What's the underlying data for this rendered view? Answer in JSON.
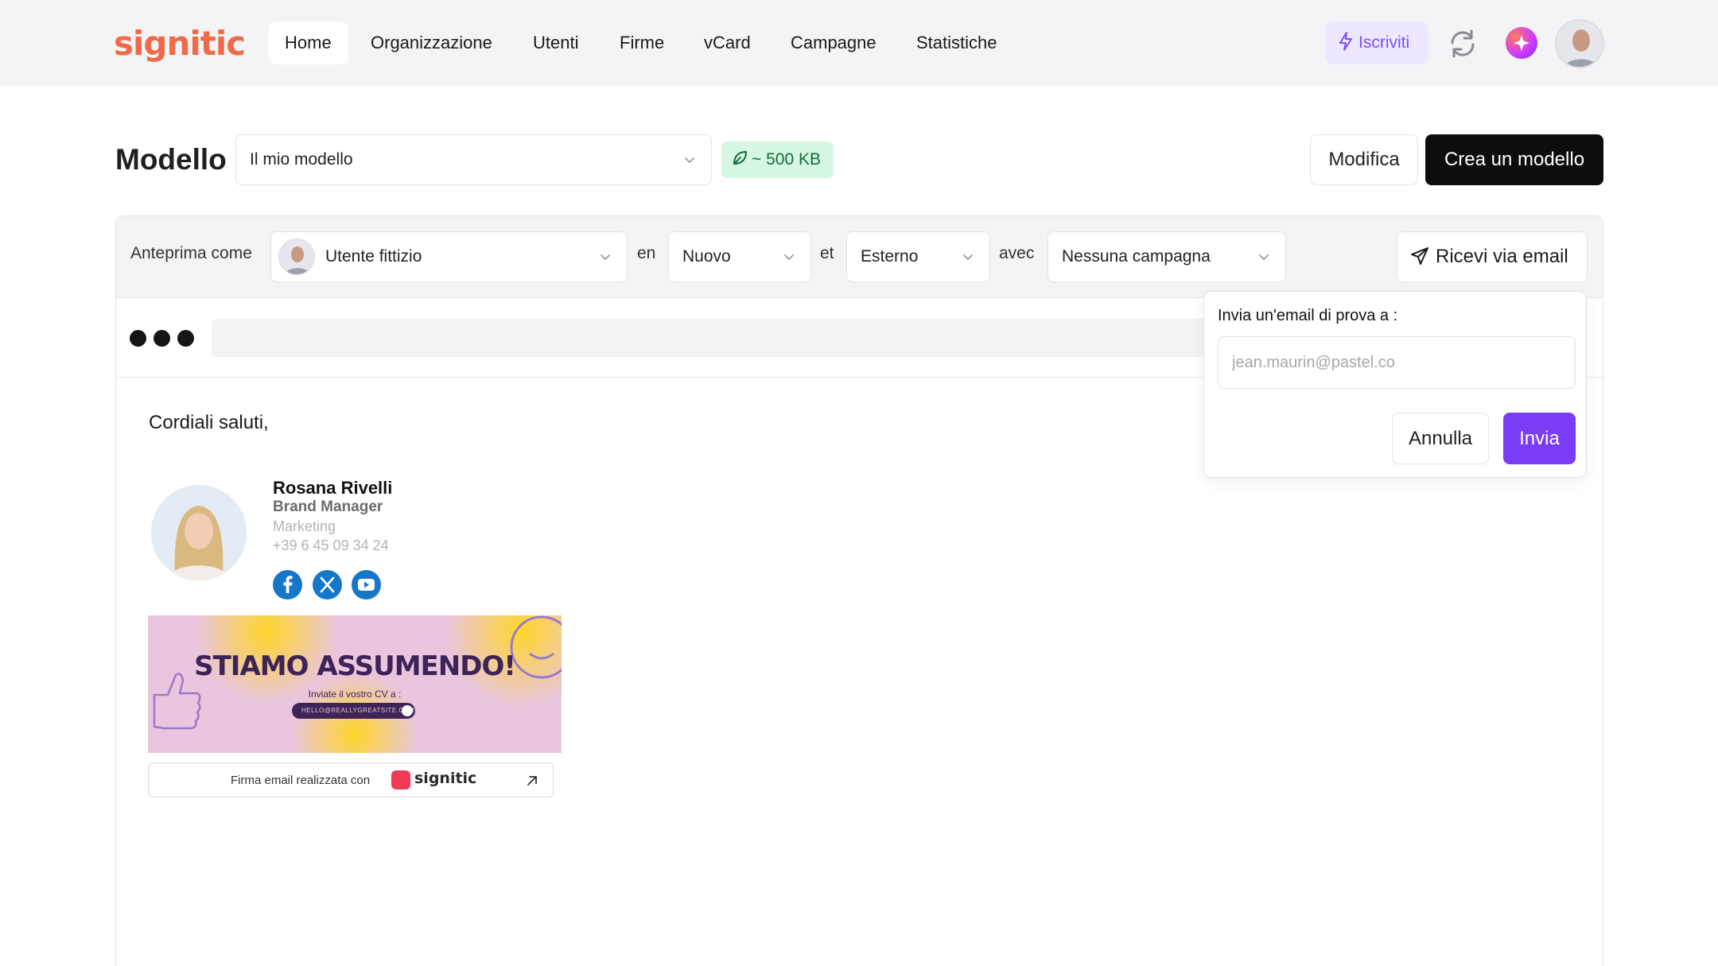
{
  "app": {
    "logo": "signitic"
  },
  "nav": {
    "items": [
      {
        "label": "Home",
        "active": true
      },
      {
        "label": "Organizzazione"
      },
      {
        "label": "Utenti"
      },
      {
        "label": "Firme"
      },
      {
        "label": "vCard"
      },
      {
        "label": "Campagne"
      },
      {
        "label": "Statistiche"
      }
    ],
    "subscribe_label": "Iscriviti",
    "icons": [
      "bolt-icon",
      "sync-icon",
      "sparkle-icon",
      "user-avatar"
    ]
  },
  "model": {
    "title": "Modello",
    "selected": "Il mio modello",
    "size_badge": "~ 500 KB",
    "edit_label": "Modifica",
    "create_label": "Crea un modello"
  },
  "preview": {
    "preview_as_label": "Anteprima come",
    "user_value": "Utente fittizio",
    "en_label": "en",
    "mode_value": "Nuovo",
    "et_label": "et",
    "recipient_value": "Esterno",
    "avec_label": "avec",
    "campaign_value": "Nessuna campagna",
    "email_button_label": "Ricevi via email"
  },
  "email": {
    "greeting": "Cordiali saluti,",
    "signature": {
      "name": "Rosana Rivelli",
      "role": "Brand Manager",
      "department": "Marketing",
      "phone": "+39 6 45 09 34 24",
      "socials": [
        "facebook-icon",
        "x-icon",
        "youtube-icon"
      ]
    },
    "banner": {
      "title": "STIAMO ASSUMENDO!",
      "subtitle": "Inviate il vostro CV a :",
      "email": "HELLO@REALLYGREATSITE.COM"
    },
    "made_with": {
      "text": "Firma email realizzata con",
      "brand": "signitic"
    }
  },
  "popover": {
    "label": "Invia un'email di prova a :",
    "placeholder": "jean.maurin@pastel.co",
    "cancel_label": "Annulla",
    "send_label": "Invia"
  },
  "colors": {
    "brand": "#f06a4a",
    "accent": "#7a3cf5",
    "badge_bg": "#d5f7e3",
    "social": "#1677c9"
  }
}
